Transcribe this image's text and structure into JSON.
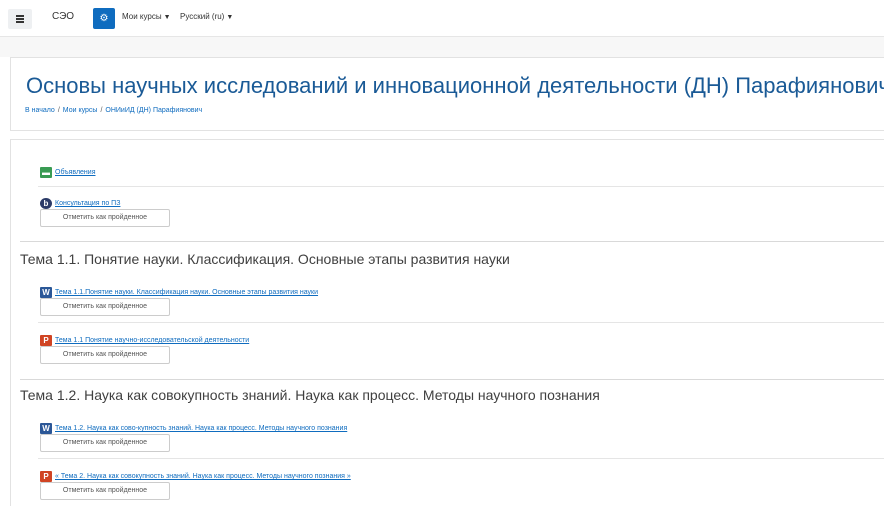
{
  "navbar": {
    "brand": "СЭО",
    "menu_courses": "Мои курсы",
    "menu_language": "Русский (ru)"
  },
  "course": {
    "title": "Основы научных исследований и инновационной деятельности (ДН) Парафиянович",
    "breadcrumb": [
      "В начало",
      "Мои курсы",
      "ОНИиИД (ДН) Парафиянович"
    ]
  },
  "mark_complete_label": "Отметить как пройденное",
  "general": {
    "announcements": "Объявления",
    "consultation": "Консультация по ПЗ"
  },
  "sections": [
    {
      "title": "Тема 1.1. Понятие науки. Классификация. Основные этапы развития науки",
      "activities": [
        {
          "icon": "word-icon",
          "label": "Тема 1.1.Понятие науки. Классификация науки. Основные этапы развития науки"
        },
        {
          "icon": "powerpoint-icon",
          "label": "Тема 1.1 Понятие научно-исследовательской деятельности"
        }
      ]
    },
    {
      "title": "Тема 1.2. Наука как совокупность знаний. Наука как процесс. Методы научного познания",
      "activities": [
        {
          "icon": "word-icon",
          "label": "Тема 1.2. Наука как сово-купность знаний. Наука как процесс. Методы научного познания"
        },
        {
          "icon": "powerpoint-icon",
          "label": "« Тема 2. Наука как совокупность знаний. Наука как процесс. Методы научного познания »"
        }
      ]
    }
  ],
  "colors": {
    "link": "#0f6cbf",
    "title": "#1a5a96",
    "forum_icon": "#399b53",
    "bbb_icon": "#2b3a67",
    "word_icon": "#2b5797",
    "ppt_icon": "#d04423"
  }
}
